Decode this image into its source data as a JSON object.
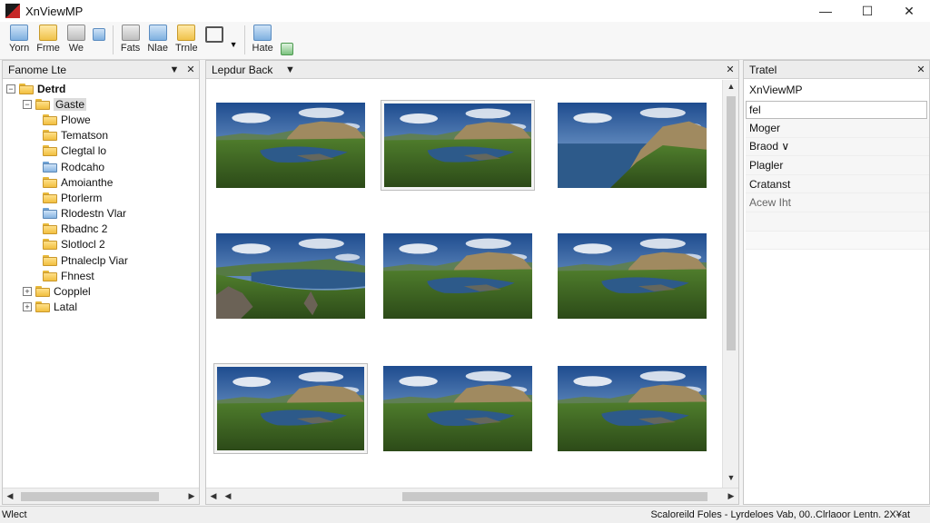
{
  "window": {
    "title": "XnViewMP",
    "controls": {
      "minimize": "—",
      "maximize": "☐",
      "close": "✕"
    }
  },
  "toolbar": {
    "items": [
      {
        "label": "Yorn",
        "icon": "browse-icon"
      },
      {
        "label": "Frme",
        "icon": "folder-icon"
      },
      {
        "label": "We",
        "icon": "view-icon"
      },
      {
        "label": "",
        "icon": "grid-icon"
      },
      {
        "label": "Fats",
        "icon": "info-icon"
      },
      {
        "label": "Nlae",
        "icon": "filter-icon"
      },
      {
        "label": "Trnle",
        "icon": "zoom-icon"
      },
      {
        "label": "",
        "icon": "search-icon"
      },
      {
        "label": "Hate",
        "icon": "copy-icon"
      },
      {
        "label": "",
        "icon": "export-icon"
      }
    ]
  },
  "folders_panel": {
    "title": "Fanome Lte",
    "tree": [
      {
        "label": "Detrd",
        "level": 0,
        "expander": "⊟",
        "selected": false,
        "bold": true,
        "color": "yellow"
      },
      {
        "label": "Gaste",
        "level": 1,
        "expander": "⊟",
        "selected": true,
        "color": "yellow"
      },
      {
        "label": "Plowe",
        "level": 2,
        "color": "yellow"
      },
      {
        "label": "Tematson",
        "level": 2,
        "color": "yellow"
      },
      {
        "label": "Clegtal lo",
        "level": 2,
        "color": "yellow"
      },
      {
        "label": "Rodcaho",
        "level": 2,
        "color": "blue"
      },
      {
        "label": "Amoianthe",
        "level": 2,
        "color": "yellow"
      },
      {
        "label": "Ptorlerm",
        "level": 2,
        "color": "yellow"
      },
      {
        "label": "Rlodestn Vlar",
        "level": 2,
        "color": "blue"
      },
      {
        "label": "Rbadnc 2",
        "level": 2,
        "color": "yellow"
      },
      {
        "label": "Slotlocl 2",
        "level": 2,
        "color": "yellow"
      },
      {
        "label": "Ptnaleclp Viar",
        "level": 2,
        "color": "yellow"
      },
      {
        "label": "Fhnest",
        "level": 2,
        "color": "yellow"
      },
      {
        "label": "Copplel",
        "level": 1,
        "expander": "⊞",
        "color": "yellow"
      },
      {
        "label": "Latal",
        "level": 1,
        "expander": "⊞",
        "color": "yellow"
      }
    ]
  },
  "browser_panel": {
    "title": "Lepdur Back",
    "thumbnails": [
      {
        "scene": "lake-cliffs"
      },
      {
        "scene": "lake-cliffs",
        "framed": true
      },
      {
        "scene": "coast-hill"
      },
      {
        "scene": "lake-rocks"
      },
      {
        "scene": "lake-cliffs"
      },
      {
        "scene": "lake-cliffs"
      },
      {
        "scene": "lake-cliffs",
        "framed": true
      },
      {
        "scene": "lake-cliffs"
      },
      {
        "scene": "lake-cliffs"
      }
    ]
  },
  "properties_panel": {
    "title": "Tratel",
    "heading": "XnViewMP",
    "input_value": "fel",
    "rows": [
      "Moger",
      "Braod ∨",
      "Plagler",
      "Cratanst",
      "Acew  Iht"
    ]
  },
  "status": {
    "left": "Wlect",
    "right": "Scaloreild Foles - Lyrdeloes Vab, 00..Clrlaoor Lentn. 2X¥at"
  },
  "colors": {
    "sky": "#3f6fb0",
    "grass": "#4f7d2c",
    "water": "#2d5a8a",
    "cliff": "#a08a60"
  }
}
